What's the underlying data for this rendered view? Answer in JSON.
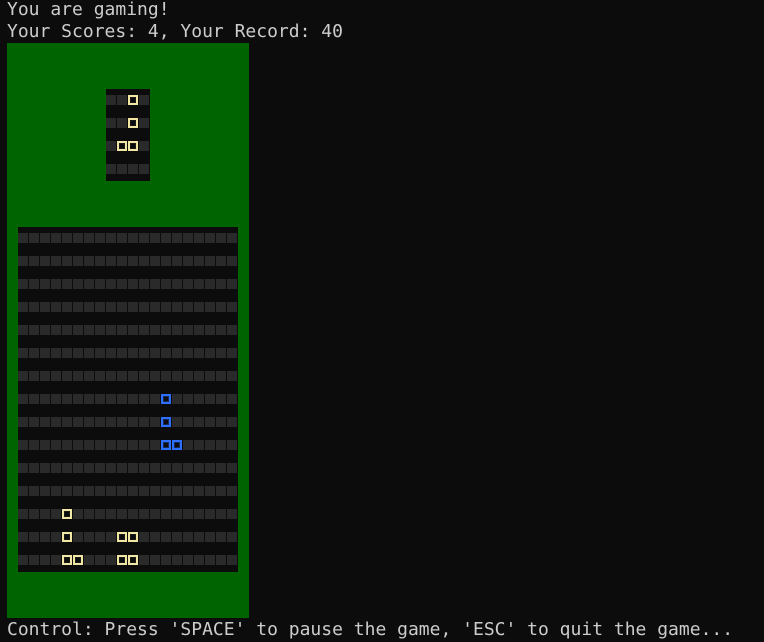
{
  "header": {
    "status": "You are gaming!",
    "scores": "Your Scores: 4, Your Record: 40"
  },
  "footer": {
    "control": "Control: Press 'SPACE' to pause the game, 'ESC' to quit the game..."
  },
  "colors": {
    "field": "#006400",
    "background": "#0c0c0c",
    "empty_cell": "#2a2a2a",
    "settled_block": "#f2e6a3",
    "falling_block": "#2d6fff",
    "text": "#cccccc"
  },
  "game": {
    "score": 4,
    "record": 40,
    "board": {
      "cols": 20,
      "rows": 15,
      "falling_piece": [
        [
          13,
          7
        ],
        [
          13,
          8
        ],
        [
          13,
          9
        ],
        [
          14,
          9
        ]
      ],
      "settled_blocks": [
        [
          4,
          12
        ],
        [
          4,
          13
        ],
        [
          4,
          14
        ],
        [
          5,
          14
        ],
        [
          9,
          13
        ],
        [
          10,
          13
        ],
        [
          9,
          14
        ],
        [
          10,
          14
        ]
      ]
    },
    "next_piece": {
      "cols": 4,
      "rows": 4,
      "blocks": [
        [
          2,
          0
        ],
        [
          2,
          1
        ],
        [
          1,
          2
        ],
        [
          2,
          2
        ]
      ]
    }
  }
}
